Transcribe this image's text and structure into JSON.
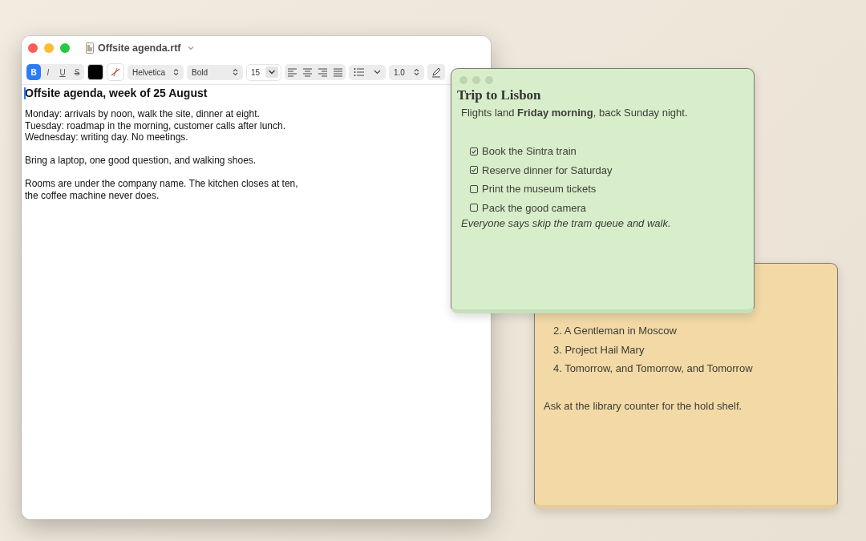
{
  "editor": {
    "title": "Offsite agenda.rtf",
    "toolbar": {
      "styles": [
        {
          "label": "B",
          "selected": true
        },
        {
          "label": "I",
          "selected": false
        },
        {
          "label": "U",
          "selected": false
        },
        {
          "label": "S",
          "selected": false
        }
      ],
      "font": "Helvetica",
      "weight": "Bold",
      "size": "15",
      "spacing": "1.0"
    },
    "paragraphs": [
      {
        "kind": "heading",
        "lines": [
          "Offsite agenda, week of 25 August"
        ]
      },
      {
        "kind": "text",
        "lines": [
          "Monday: arrivals by noon, walk the site, dinner at eight.",
          "Tuesday: roadmap in the morning, customer calls after lunch.",
          "Wednesday: writing day. No meetings."
        ]
      },
      {
        "kind": "text",
        "lines": [
          "Bring a laptop, one good question, and walking shoes."
        ]
      },
      {
        "kind": "text",
        "lines": [
          "Rooms are under the company name. The kitchen closes at ten,",
          "the coffee machine never does."
        ]
      }
    ]
  },
  "green_note": {
    "title": "Trip to Lisbon",
    "intro": "Flights land **Friday morning**, back Sunday night.",
    "checklist": [
      {
        "label": "Book the Sintra train",
        "checked": true
      },
      {
        "label": "Reserve dinner for Saturday",
        "checked": true
      },
      {
        "label": "Print the museum tickets",
        "checked": false
      },
      {
        "label": "Pack the good camera",
        "checked": false
      }
    ],
    "footnote": "Everyone says skip the tram queue and walk."
  },
  "yellow_note": {
    "list": [
      "2. A Gentleman in Moscow",
      "3. Project Hail Mary",
      "4. Tomorrow, and Tomorrow, and Tomorrow"
    ],
    "note": "Ask at the library counter for the hold shelf."
  }
}
